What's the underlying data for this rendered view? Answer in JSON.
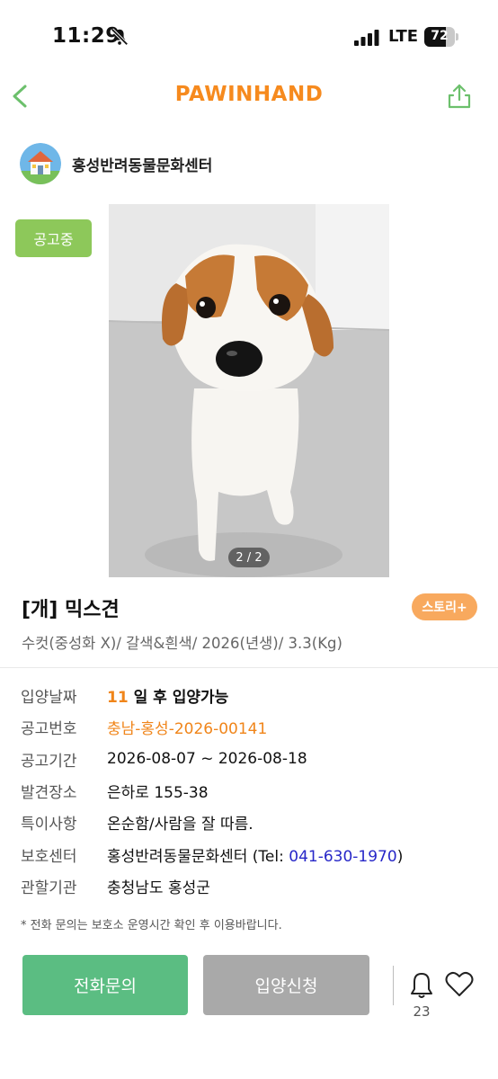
{
  "status_bar": {
    "time": "11:29",
    "network": "LTE",
    "battery": "72",
    "battery_level": 0.72
  },
  "header": {
    "brand": "PAWINHAND"
  },
  "shelter": {
    "name": "홍성반려동물문화센터"
  },
  "listing": {
    "status_badge": "공고중",
    "photo_counter": "2 / 2",
    "title": "[개] 믹스견",
    "story_button": "스토리+",
    "summary": "수컷(중성화 X)/ 갈색&흰색/ 2026(년생)/ 3.3(Kg)"
  },
  "details": {
    "adoption_date": {
      "label": "입양날짜",
      "days": "11",
      "suffix": "일 후 입양가능"
    },
    "notice_number": {
      "label": "공고번호",
      "value": "충남-홍성-2026-00141"
    },
    "notice_period": {
      "label": "공고기간",
      "value": "2026-08-07 ~ 2026-08-18"
    },
    "found_place": {
      "label": "발견장소",
      "value": "은하로 155-38"
    },
    "special_notes": {
      "label": "특이사항",
      "value": "온순함/사람을 잘 따름."
    },
    "shelter_center": {
      "label": "보호센터",
      "name": "홍성반려동물문화센터 (Tel: ",
      "phone": "041-630-1970",
      "close": ")"
    },
    "authority": {
      "label": "관할기관",
      "value": "충청남도 홍성군"
    }
  },
  "footnote": "* 전화 문의는 보호소 운영시간 확인 후 이용바랍니다.",
  "actions": {
    "call": "전화문의",
    "adopt": "입양신청",
    "alarm_count": "23"
  },
  "colors": {
    "brand": "#f68a1e",
    "badge": "#8dc85a",
    "story": "#f8a95e",
    "call": "#5bbd82",
    "adopt": "#a9a9a9",
    "header_icon": "#6cc06c",
    "phone_link": "#2727c8"
  },
  "icons": {
    "back": "chevron-left-icon",
    "share": "share-icon",
    "alarm": "bell-icon",
    "favorite": "heart-icon",
    "mute": "bell-slash-icon"
  }
}
